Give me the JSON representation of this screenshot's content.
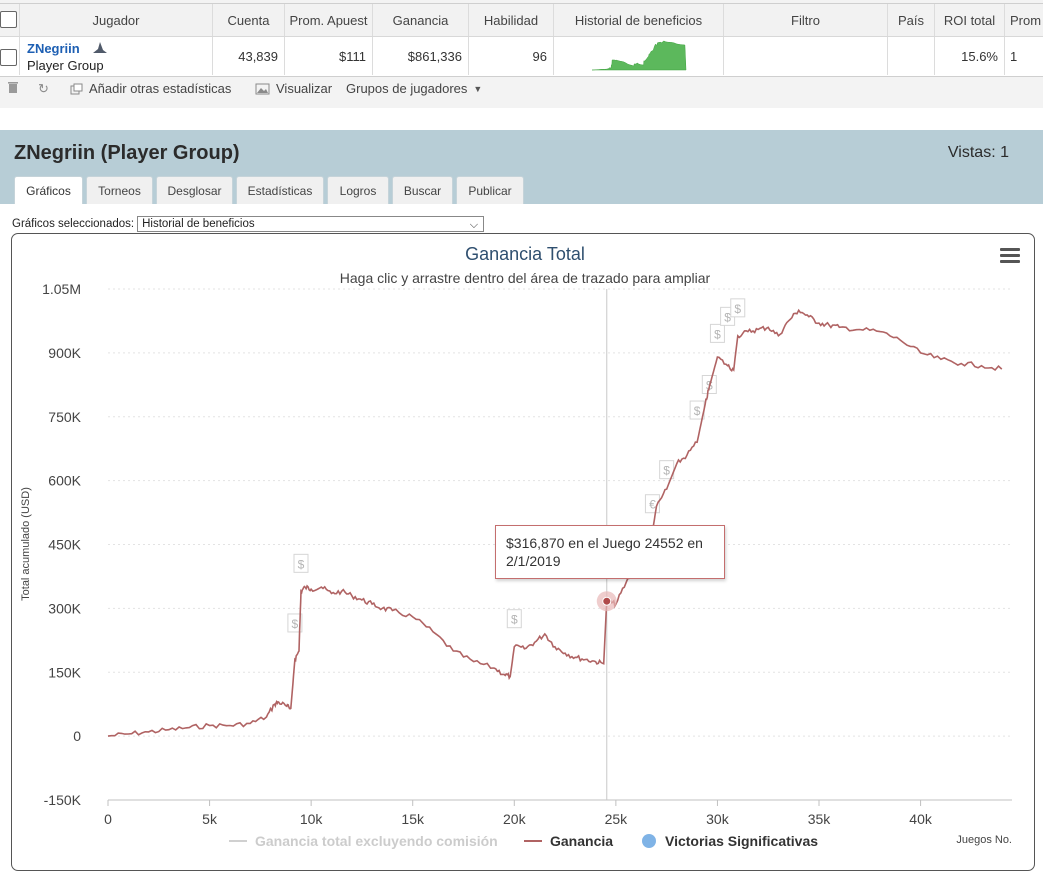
{
  "grid": {
    "columns": [
      "Jugador",
      "Cuenta",
      "Prom. Apuest",
      "Ganancia",
      "Habilidad",
      "Historial de beneficios",
      "Filtro",
      "País",
      "ROI total",
      "Prom"
    ],
    "row": {
      "name": "ZNegriin",
      "group": "Player Group",
      "count": "43,839",
      "avg_bet": "$111",
      "profit": "$861,336",
      "skill": "96",
      "roi": "15.6%",
      "prom": "1"
    }
  },
  "toolbar": {
    "add_stats": "Añadir otras estadísticas",
    "visualize": "Visualizar",
    "groups": "Grupos de jugadores"
  },
  "panel": {
    "title": "ZNegriin (Player Group)",
    "views": "Vistas: 1",
    "tabs": [
      "Gráficos",
      "Torneos",
      "Desglosar",
      "Estadísticas",
      "Logros",
      "Buscar",
      "Publicar"
    ],
    "active_tab": "Gráficos",
    "selector_label": "Gráficos seleccionados:",
    "selector_value": "Historial de beneficios"
  },
  "tooltip": {
    "line1": "$316,870 en el Juego 24552 en",
    "line2": "2/1/2019"
  },
  "chart_data": {
    "type": "line",
    "title": "Ganancia Total",
    "subtitle": "Haga clic y arrastre dentro del área de trazado para ampliar",
    "ylabel": "Total acumulado (USD)",
    "xlabel": "Juegos No.",
    "xlim": [
      0,
      44500
    ],
    "ylim": [
      -150000,
      1050000
    ],
    "x_ticks": [
      0,
      5000,
      10000,
      15000,
      20000,
      25000,
      30000,
      35000,
      40000
    ],
    "x_tick_labels": [
      "0",
      "5k",
      "10k",
      "15k",
      "20k",
      "25k",
      "30k",
      "35k",
      "40k"
    ],
    "y_ticks": [
      -150000,
      0,
      150000,
      300000,
      450000,
      600000,
      750000,
      900000,
      1050000
    ],
    "y_tick_labels": [
      "-150K",
      "0",
      "150K",
      "300K",
      "450K",
      "600K",
      "750K",
      "900K",
      "1.05M"
    ],
    "grid": true,
    "legend_position": "bottom",
    "series": [
      {
        "name": "Ganancia total excluyendo comisión",
        "color": "#cccccc",
        "visible": false,
        "x": [],
        "y": []
      },
      {
        "name": "Ganancia",
        "color": "#b06363",
        "x": [
          0,
          1000,
          2000,
          3000,
          4000,
          5000,
          6000,
          7000,
          7800,
          8200,
          8400,
          8800,
          9000,
          9200,
          9400,
          9500,
          9700,
          10000,
          10500,
          11000,
          11500,
          12000,
          12500,
          13000,
          13500,
          14000,
          15000,
          16000,
          17000,
          18000,
          19000,
          19500,
          19800,
          20000,
          20500,
          21000,
          21500,
          22000,
          22500,
          23000,
          23500,
          24000,
          24400,
          24552,
          24700,
          25000,
          25500,
          26000,
          26500,
          26800,
          27000,
          27500,
          28000,
          28500,
          29000,
          29400,
          29600,
          30000,
          30500,
          30800,
          31000,
          31500,
          32000,
          32500,
          33000,
          33500,
          34000,
          34500,
          35000,
          35500,
          36000,
          37000,
          38000,
          39000,
          40000,
          41000,
          42000,
          43000,
          44000
        ],
        "y": [
          0,
          5000,
          10000,
          15000,
          20000,
          25000,
          25000,
          30000,
          45000,
          75000,
          80000,
          70000,
          65000,
          180000,
          200000,
          340000,
          350000,
          345000,
          350000,
          335000,
          340000,
          330000,
          320000,
          310000,
          300000,
          295000,
          280000,
          245000,
          200000,
          175000,
          160000,
          145000,
          140000,
          210000,
          205000,
          220000,
          240000,
          210000,
          195000,
          185000,
          180000,
          175000,
          170000,
          316870,
          315000,
          310000,
          360000,
          400000,
          450000,
          480000,
          540000,
          580000,
          640000,
          660000,
          690000,
          780000,
          820000,
          890000,
          870000,
          860000,
          940000,
          950000,
          955000,
          960000,
          940000,
          975000,
          1000000,
          985000,
          970000,
          965000,
          960000,
          955000,
          950000,
          930000,
          900000,
          885000,
          875000,
          870000,
          862000
        ]
      }
    ],
    "significant_wins_legend": "Victorias Significativas",
    "significant_wins": [
      {
        "x": 9200,
        "y": 200000,
        "label": "$"
      },
      {
        "x": 9500,
        "y": 340000,
        "label": "$"
      },
      {
        "x": 20000,
        "y": 210000,
        "label": "$"
      },
      {
        "x": 26800,
        "y": 480000,
        "label": "€"
      },
      {
        "x": 27500,
        "y": 560000,
        "label": "$"
      },
      {
        "x": 29000,
        "y": 700000,
        "label": "$"
      },
      {
        "x": 29600,
        "y": 760000,
        "label": "$"
      },
      {
        "x": 30000,
        "y": 880000,
        "label": "$"
      },
      {
        "x": 30500,
        "y": 920000,
        "label": "$"
      },
      {
        "x": 31000,
        "y": 940000,
        "label": "$"
      }
    ],
    "highlight": {
      "x": 24552,
      "y": 316870
    }
  }
}
